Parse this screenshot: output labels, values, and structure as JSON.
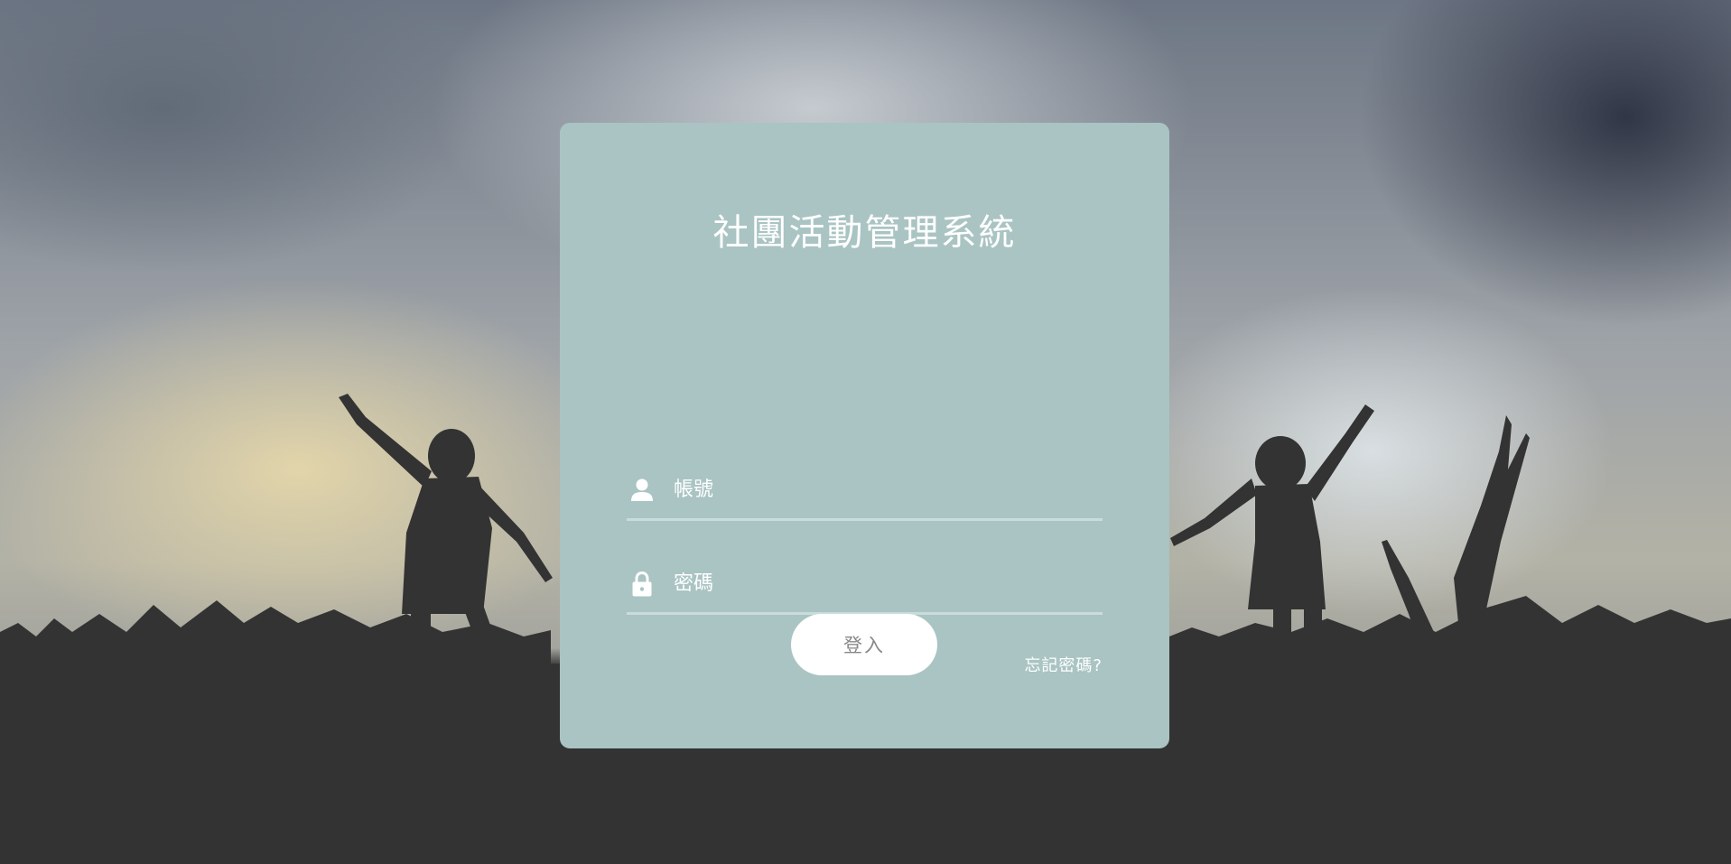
{
  "login": {
    "title": "社團活動管理系統",
    "account_placeholder": "帳號",
    "password_placeholder": "密碼",
    "forgot_password": "忘記密碼?",
    "submit_label": "登入"
  },
  "icons": {
    "account": "user-icon",
    "password": "lock-icon"
  },
  "colors": {
    "card_background": "#a9c4c3",
    "field_underline": "#c9dcdb",
    "button_background": "#ffffff",
    "button_text": "#888888"
  }
}
